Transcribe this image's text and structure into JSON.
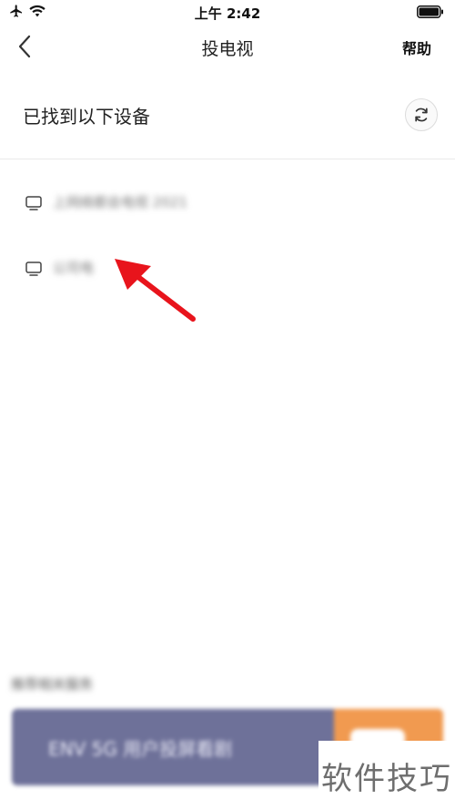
{
  "status_bar": {
    "time": "上午 2:42",
    "airplane_icon": "airplane-icon",
    "wifi_icon": "wifi-icon",
    "battery_icon": "battery-icon"
  },
  "nav": {
    "title": "投电视",
    "help": "帮助",
    "back_icon": "chevron-left-icon"
  },
  "section": {
    "title": "已找到以下设备",
    "refresh_icon": "refresh-icon"
  },
  "devices": [
    {
      "name": "上网络都会电视 2021",
      "icon": "tv-icon"
    },
    {
      "name": "公司电",
      "icon": "tv-icon"
    }
  ],
  "ad": {
    "label": "推荐相关服务",
    "banner_text": "ENV 5G 用户投屏看剧"
  },
  "watermark": {
    "text": "软件技巧"
  },
  "colors": {
    "annotation_arrow": "#e8141c",
    "ad_banner": "#6e7199",
    "ad_accent": "#f19a50"
  }
}
